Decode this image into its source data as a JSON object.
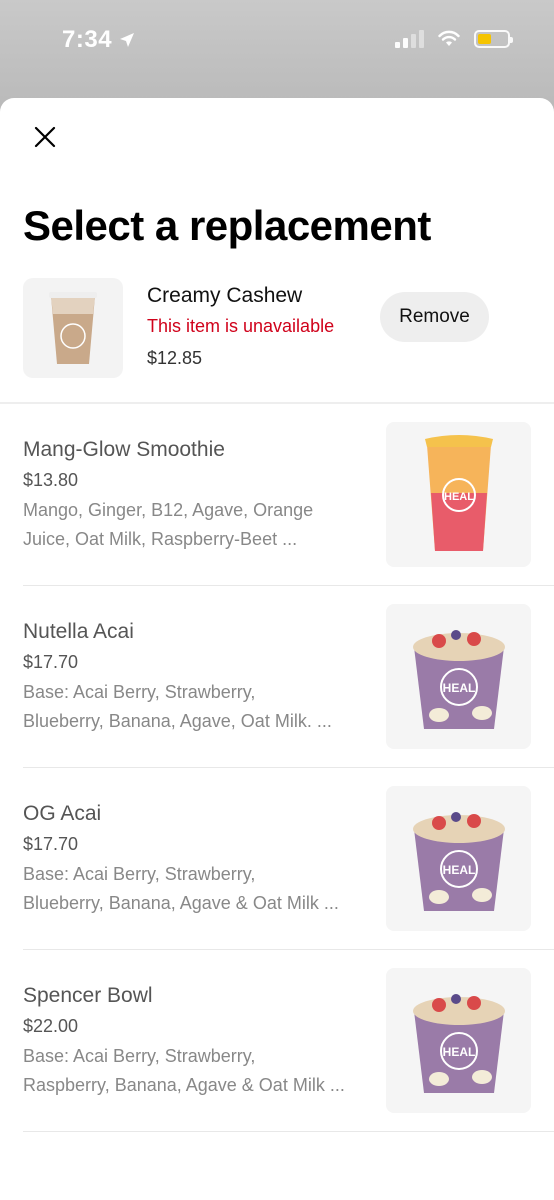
{
  "status_bar": {
    "time": "7:34",
    "battery_color": "#f5c400"
  },
  "sheet": {
    "title": "Select a replacement",
    "close_icon": "close-icon"
  },
  "current_item": {
    "name": "Creamy Cashew",
    "status": "This item is unavailable",
    "price": "$12.85",
    "remove_label": "Remove"
  },
  "replacements": [
    {
      "name": "Mang-Glow Smoothie",
      "price": "$13.80",
      "desc_line1": "Mango, Ginger, B12, Agave, Orange",
      "desc_line2": "Juice, Oat Milk, Raspberry-Beet ...",
      "image": "smoothie-cup"
    },
    {
      "name": "Nutella Acai",
      "price": "$17.70",
      "desc_line1": "Base: Acai Berry, Strawberry,",
      "desc_line2": "Blueberry, Banana, Agave, Oat Milk. ...",
      "image": "acai-bowl"
    },
    {
      "name": "OG Acai",
      "price": "$17.70",
      "desc_line1": "Base: Acai Berry, Strawberry,",
      "desc_line2": "Blueberry, Banana, Agave & Oat Milk ...",
      "image": "acai-bowl"
    },
    {
      "name": "Spencer Bowl",
      "price": "$22.00",
      "desc_line1": "Base: Acai Berry, Strawberry,",
      "desc_line2": "Raspberry, Banana, Agave & Oat Milk ...",
      "image": "acai-bowl"
    }
  ],
  "brand_mark": "HEAL",
  "colors": {
    "unavailable": "#d0021b",
    "remove_button_bg": "#eeeeee"
  }
}
